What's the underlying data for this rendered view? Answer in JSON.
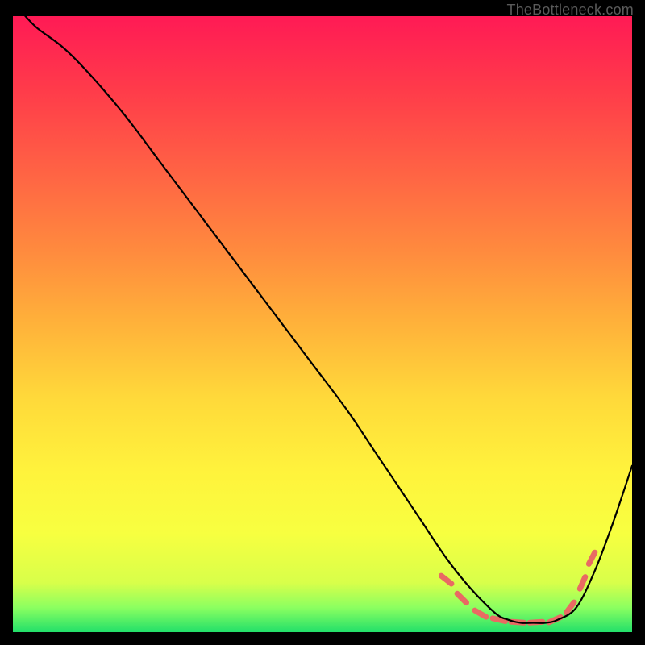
{
  "attribution": "TheBottleneck.com",
  "colors": {
    "page_bg": "#000000",
    "curve": "#000000",
    "dash": "#e96a63",
    "gradient_top": "#ff1a55",
    "gradient_bottom": "#22e06a"
  },
  "chart_data": {
    "type": "line",
    "title": "",
    "xlabel": "",
    "ylabel": "",
    "xlim": [
      0,
      100
    ],
    "ylim": [
      0,
      100
    ],
    "grid": false,
    "axes_drawn": false,
    "series": [
      {
        "name": "bottleneck-curve",
        "x": [
          2,
          4,
          8,
          12,
          18,
          24,
          30,
          36,
          42,
          48,
          54,
          58,
          62,
          66,
          70,
          74,
          78,
          80,
          82,
          84,
          86,
          88,
          91,
          94,
          97,
          100
        ],
        "y": [
          100,
          98,
          95,
          91,
          84,
          76,
          68,
          60,
          52,
          44,
          36,
          30,
          24,
          18,
          12,
          7,
          3,
          2,
          1.5,
          1.5,
          1.5,
          2,
          4,
          10,
          18,
          27
        ]
      }
    ],
    "markers": [
      {
        "name": "valley-dash-1",
        "x": 70.0,
        "y": 8.5
      },
      {
        "name": "valley-dash-2",
        "x": 72.5,
        "y": 5.5
      },
      {
        "name": "valley-dash-3",
        "x": 75.5,
        "y": 3.0
      },
      {
        "name": "valley-dash-4",
        "x": 78.5,
        "y": 2.0
      },
      {
        "name": "valley-dash-5",
        "x": 81.5,
        "y": 1.6
      },
      {
        "name": "valley-dash-6",
        "x": 84.5,
        "y": 1.6
      },
      {
        "name": "valley-dash-7",
        "x": 87.5,
        "y": 2.0
      },
      {
        "name": "valley-dash-8",
        "x": 90.0,
        "y": 4.0
      },
      {
        "name": "valley-dash-9",
        "x": 92.0,
        "y": 8.0
      },
      {
        "name": "valley-dash-10",
        "x": 93.5,
        "y": 12.0
      }
    ],
    "notes": "No numeric axis ticks or labels are present in the source image; x and y are expressed as 0–100 percentages of the plot area. The curve is a black line with short salmon-colored dashes highlighting the valley region near the bottom-right."
  }
}
